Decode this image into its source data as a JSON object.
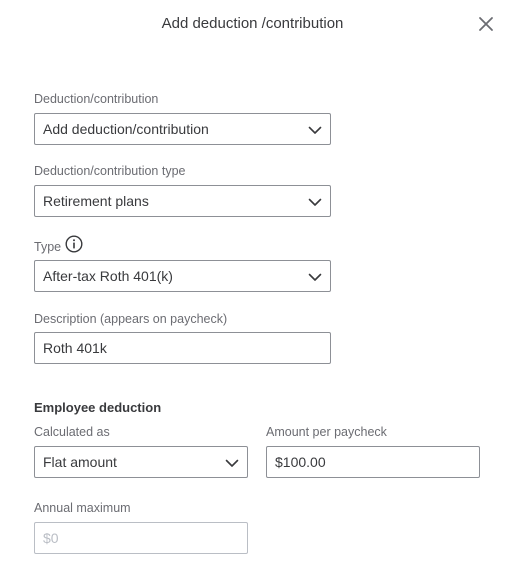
{
  "dialog": {
    "title": "Add deduction /contribution"
  },
  "fields": {
    "deduction": {
      "label": "Deduction/contribution",
      "value": "Add deduction/contribution"
    },
    "deduction_type": {
      "label": "Deduction/contribution type",
      "value": "Retirement plans"
    },
    "type": {
      "label": "Type",
      "value": "After-tax Roth 401(k)"
    },
    "description": {
      "label": "Description (appears on paycheck)",
      "value": "Roth 401k"
    }
  },
  "employee_deduction": {
    "heading": "Employee deduction",
    "calculated_as": {
      "label": "Calculated as",
      "value": "Flat amount"
    },
    "amount_per_paycheck": {
      "label": "Amount per paycheck",
      "value": "$100.00"
    },
    "annual_maximum": {
      "label": "Annual maximum",
      "placeholder": "$0"
    }
  },
  "icons": {
    "close": "close-icon",
    "chevron": "chevron-down-icon",
    "info": "info-icon"
  },
  "colors": {
    "text": "#393a3d",
    "label": "#6b6c72",
    "border": "#8d9096",
    "disabled": "#babec5"
  }
}
